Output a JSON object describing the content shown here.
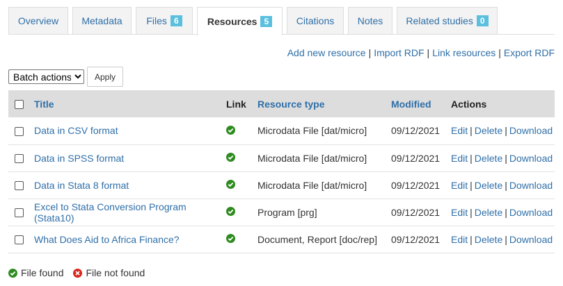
{
  "tabs": [
    {
      "label": "Overview",
      "badge": null
    },
    {
      "label": "Metadata",
      "badge": null
    },
    {
      "label": "Files",
      "badge": "6"
    },
    {
      "label": "Resources",
      "badge": "5",
      "active": true
    },
    {
      "label": "Citations",
      "badge": null
    },
    {
      "label": "Notes",
      "badge": null
    },
    {
      "label": "Related studies",
      "badge": "0"
    }
  ],
  "actions": {
    "add": "Add new resource",
    "import": "Import RDF",
    "link": "Link resources",
    "export": "Export RDF",
    "separator": "|"
  },
  "batch": {
    "selected": "Batch actions",
    "apply": "Apply"
  },
  "table": {
    "headers": {
      "title": "Title",
      "link": "Link",
      "type": "Resource type",
      "modified": "Modified",
      "actions": "Actions"
    },
    "rows": [
      {
        "title": "Data in CSV format",
        "type": "Microdata File [dat/micro]",
        "modified": "09/12/2021"
      },
      {
        "title": "Data in SPSS format",
        "type": "Microdata File [dat/micro]",
        "modified": "09/12/2021"
      },
      {
        "title": "Data in Stata 8 format",
        "type": "Microdata File [dat/micro]",
        "modified": "09/12/2021"
      },
      {
        "title": "Excel to Stata Conversion Program (Stata10)",
        "type": "Program [prg]",
        "modified": "09/12/2021"
      },
      {
        "title": "What Does Aid to Africa Finance?",
        "type": "Document, Report [doc/rep]",
        "modified": "09/12/2021"
      }
    ],
    "row_actions": {
      "edit": "Edit",
      "delete": "Delete",
      "download": "Download"
    }
  },
  "legend": {
    "found": "File found",
    "not_found": "File not found"
  },
  "colors": {
    "link": "#2f6fa8",
    "badge": "#5bc0de",
    "found": "#2e8b1f",
    "not_found": "#d9261c",
    "header_bg": "#dddddd"
  }
}
